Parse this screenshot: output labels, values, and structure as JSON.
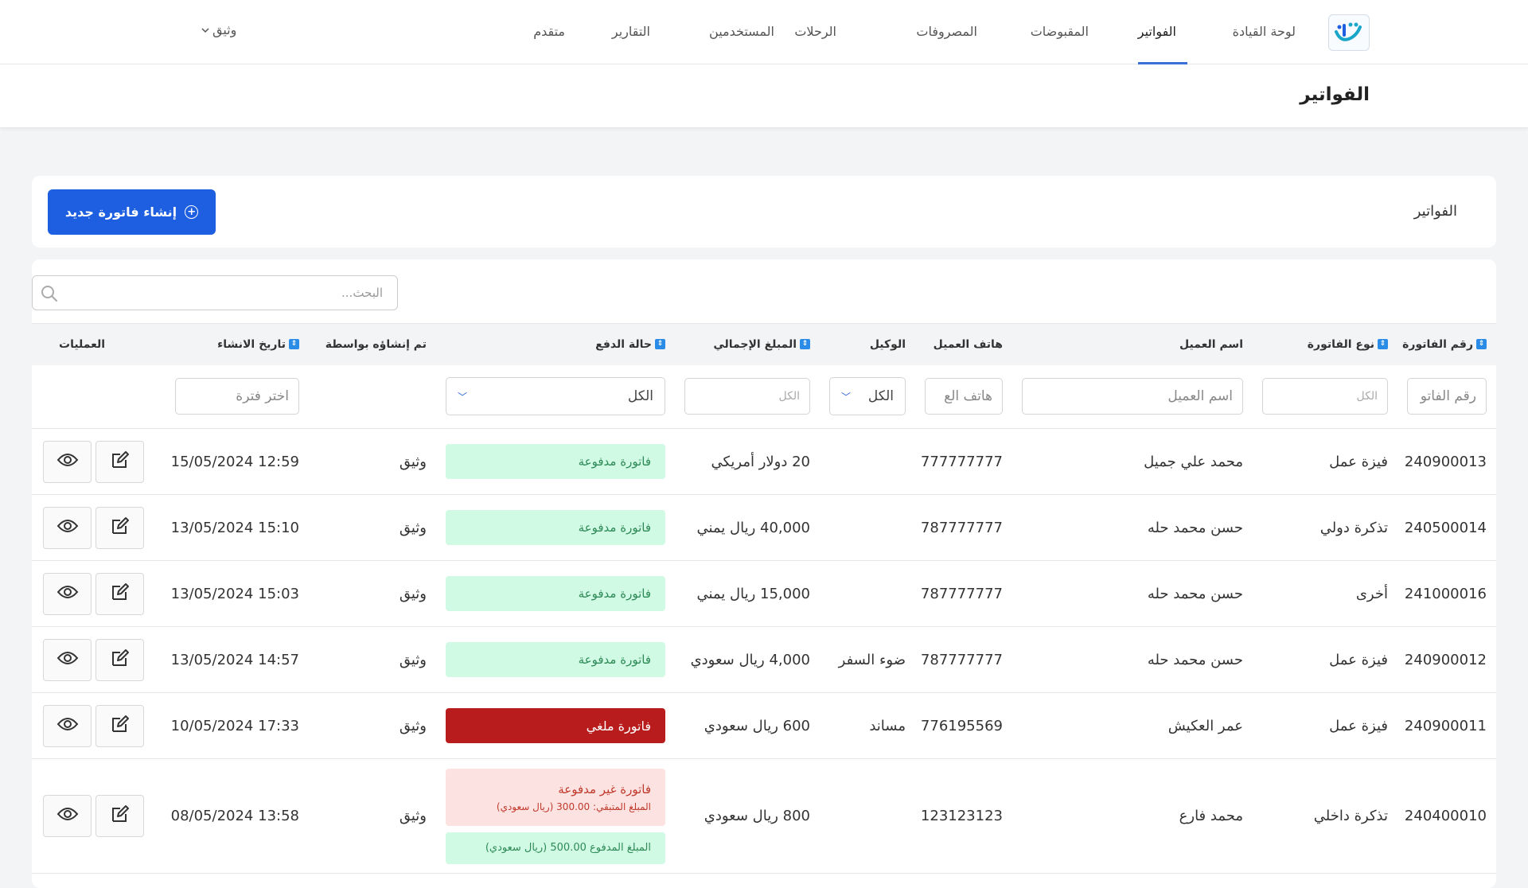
{
  "nav": {
    "items": [
      {
        "label": "لوحة القيادة",
        "active": false
      },
      {
        "label": "الفواتير",
        "active": true
      },
      {
        "label": "المقبوضات",
        "active": false
      },
      {
        "label": "المصروفات",
        "active": false
      },
      {
        "label": "الرحلات",
        "active": false
      },
      {
        "label": "المستخدمين",
        "active": false
      },
      {
        "label": "التقارير",
        "active": false
      },
      {
        "label": "متقدم",
        "active": false
      }
    ],
    "user": "وثيق",
    "accent": "#3b6fd8"
  },
  "page": {
    "title": "الفواتير"
  },
  "card": {
    "title": "الفواتير",
    "create_button": "إنشاء فاتورة جديد",
    "button_color": "#1d5fe0"
  },
  "search": {
    "placeholder": "البحث..."
  },
  "table": {
    "headers": {
      "invoice_no": "رقم الفاتورة",
      "invoice_type": "نوع الفاتورة",
      "client_name": "اسم العميل",
      "client_phone": "هاتف العميل",
      "agent": "الوكيل",
      "total": "المبلغ الإجمالي",
      "payment_status": "حالة الدفع",
      "created_by": "تم إنشاؤه بواسطة",
      "created_at": "تاريخ الانشاء",
      "operations": "العمليات"
    },
    "filters": {
      "invoice_no": "رقم الفاتو",
      "invoice_type": "الكل",
      "client_name": "اسم العميل",
      "client_phone": "هاتف الع",
      "agent": "الكل",
      "total": "الكل",
      "payment_status": "الكل",
      "created_at": "اختر فترة"
    },
    "rows": [
      {
        "invoice_no": "240900013",
        "type": "فيزة عمل",
        "client": "محمد علي جميل",
        "phone": "777777777",
        "agent": "",
        "total": "20 دولار أمريكي",
        "status": "paid",
        "status_label": "فاتورة مدفوعة",
        "created_by": "وثيق",
        "created_at": "12:59 15/05/2024"
      },
      {
        "invoice_no": "240500014",
        "type": "تذكرة دولي",
        "client": "حسن محمد حله",
        "phone": "787777777",
        "agent": "",
        "total": "40,000 ريال يمني",
        "status": "paid",
        "status_label": "فاتورة مدفوعة",
        "created_by": "وثيق",
        "created_at": "15:10 13/05/2024"
      },
      {
        "invoice_no": "241000016",
        "type": "أخرى",
        "client": "حسن محمد حله",
        "phone": "787777777",
        "agent": "",
        "total": "15,000 ريال يمني",
        "status": "paid",
        "status_label": "فاتورة مدفوعة",
        "created_by": "وثيق",
        "created_at": "15:03 13/05/2024"
      },
      {
        "invoice_no": "240900012",
        "type": "فيزة عمل",
        "client": "حسن محمد حله",
        "phone": "787777777",
        "agent": "ضوء السفر",
        "total": "4,000 ريال سعودي",
        "status": "paid",
        "status_label": "فاتورة مدفوعة",
        "created_by": "وثيق",
        "created_at": "14:57 13/05/2024"
      },
      {
        "invoice_no": "240900011",
        "type": "فيزة عمل",
        "client": "عمر العكيش",
        "phone": "776195569",
        "agent": "مساند",
        "total": "600 ريال سعودي",
        "status": "cancel",
        "status_label": "فاتورة ملغي",
        "created_by": "وثيق",
        "created_at": "17:33 10/05/2024"
      },
      {
        "invoice_no": "240400010",
        "type": "تذكرة داخلي",
        "client": "محمد فارع",
        "phone": "123123123",
        "agent": "",
        "total": "800 ريال سعودي",
        "status": "unpaid",
        "status_label": "فاتورة غير مدفوعة",
        "remaining": "المبلغ المتبقي: 300.00 (ريال سعودي)",
        "paid_note": "المبلغ المدفوع 500.00 (ريال سعودي)",
        "created_by": "وثيق",
        "created_at": "13:58 08/05/2024"
      }
    ]
  },
  "colors": {
    "paid_bg": "#d1fae5",
    "cancel_bg": "#b91c1c",
    "unpaid_bg": "#fde2e2"
  }
}
